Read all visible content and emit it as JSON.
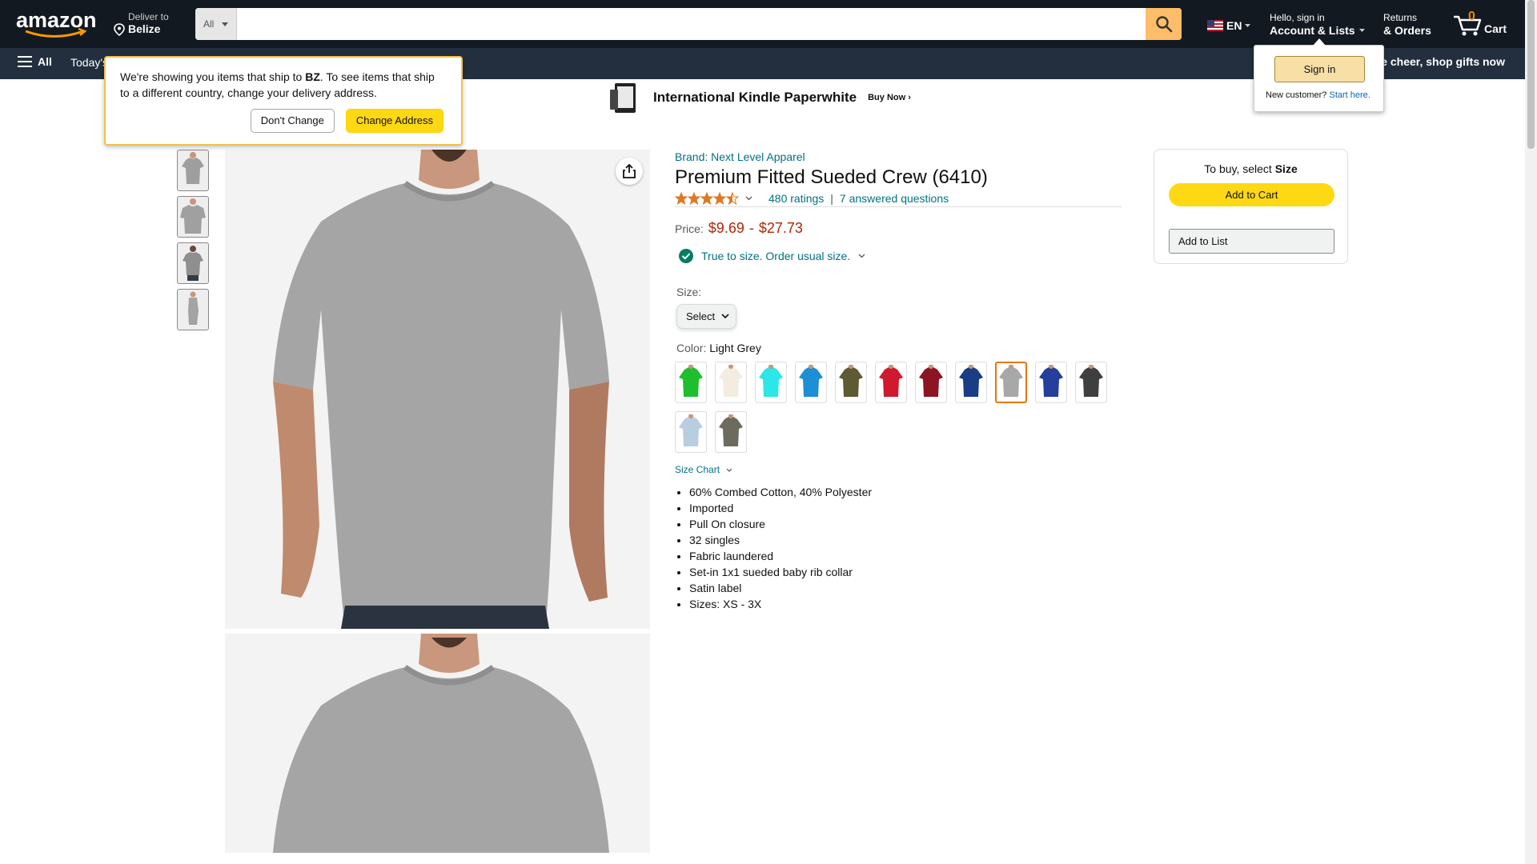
{
  "header": {
    "deliver_line1": "Deliver to",
    "deliver_line2": "Belize",
    "search_dept": "All",
    "search_placeholder": "",
    "lang": "EN",
    "account_line1": "Hello, sign in",
    "account_line2": "Account & Lists",
    "orders_line1": "Returns",
    "orders_line2": "& Orders",
    "cart_count": "0",
    "cart_label": "Cart"
  },
  "subnav": {
    "all_label": "All",
    "today_label": "Today's Deals",
    "promo": "e cheer, shop gifts now"
  },
  "banner": {
    "title": "International Kindle Paperwhite",
    "cta": "Buy Now ›"
  },
  "location_popover": {
    "text_before": "We're showing you items that ship to ",
    "country": "BZ",
    "text_after": ". To see items that ship to a different country, change your delivery address.",
    "dont_change": "Don't Change",
    "change_address": "Change Address"
  },
  "signin_popover": {
    "button": "Sign in",
    "new_customer": "New customer?",
    "start_here": "Start here."
  },
  "product": {
    "brand": "Brand: Next Level Apparel",
    "title": "Premium Fitted Sueded Crew (6410)",
    "rating_value": 4.5,
    "ratings_count": "480 ratings",
    "questions": "7 answered questions",
    "price_label": "Price:",
    "price_low": "$9.69",
    "price_dash": "-",
    "price_high": "$27.73",
    "fit_text": "True to size. Order usual size.",
    "size_label": "Size:",
    "size_select": "Select",
    "color_label": "Color:",
    "color_value": "Light Grey",
    "swatch_colors": [
      "#1fbe2e",
      "#f2ede0",
      "#2ce6e8",
      "#1d8fd4",
      "#5d5a34",
      "#d0192f",
      "#8c1523",
      "#1b3d86",
      "#a8a8a8",
      "#243f9c",
      "#3f3f3f",
      "#b9cde0",
      "#6d6b5e"
    ],
    "selected_swatch": 8,
    "size_chart": "Size Chart",
    "bullets": [
      "60% Combed Cotton, 40% Polyester",
      "Imported",
      "Pull On closure",
      "32 singles",
      "Fabric laundered",
      "Set-in 1x1 sueded baby rib collar",
      "Satin label",
      "Sizes: XS - 3X"
    ]
  },
  "buybox": {
    "to_buy": "To buy, select ",
    "size_word": "Size",
    "add_to_cart": "Add to Cart",
    "add_to_list": "Add to List"
  },
  "colors": {
    "nav_dark": "#131921",
    "nav_sub": "#232f3e",
    "accent_orange": "#febd69",
    "link": "#007185",
    "price": "#b12704",
    "button_yellow": "#ffd814"
  }
}
